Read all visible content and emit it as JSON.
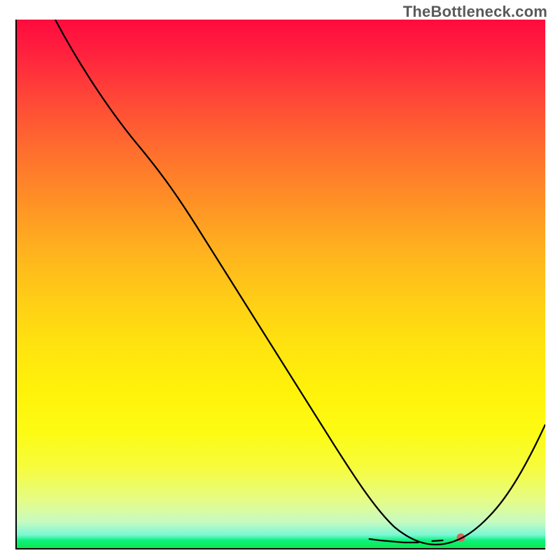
{
  "watermark": "TheBottleneck.com",
  "chart_data": {
    "type": "line",
    "title": "",
    "xlabel": "",
    "ylabel": "",
    "xlim": [
      0,
      100
    ],
    "ylim": [
      0,
      100
    ],
    "grid": false,
    "legend": false,
    "background": "vertical-gradient (red → orange → yellow → green)",
    "series": [
      {
        "name": "curve",
        "color": "#000000",
        "x": [
          7,
          15,
          22,
          28,
          35,
          42,
          50,
          57,
          63,
          68,
          72,
          76,
          80,
          84,
          88,
          92,
          96,
          100
        ],
        "y": [
          100,
          87,
          76,
          67,
          56,
          45,
          33,
          22,
          13,
          6,
          2,
          0,
          0,
          1,
          5,
          12,
          20,
          29
        ]
      }
    ],
    "markers": [
      {
        "name": "highlight-band",
        "color": "#d86a5a",
        "shape": "thick-segment",
        "x_range": [
          68,
          85
        ],
        "y": 1
      }
    ],
    "colors": {
      "gradient_stops": [
        {
          "pos": 0.0,
          "hex": "#ff0b3e"
        },
        {
          "pos": 0.5,
          "hex": "#ffd015"
        },
        {
          "pos": 0.85,
          "hex": "#f6fc3f"
        },
        {
          "pos": 1.0,
          "hex": "#0be84f"
        }
      ]
    }
  }
}
